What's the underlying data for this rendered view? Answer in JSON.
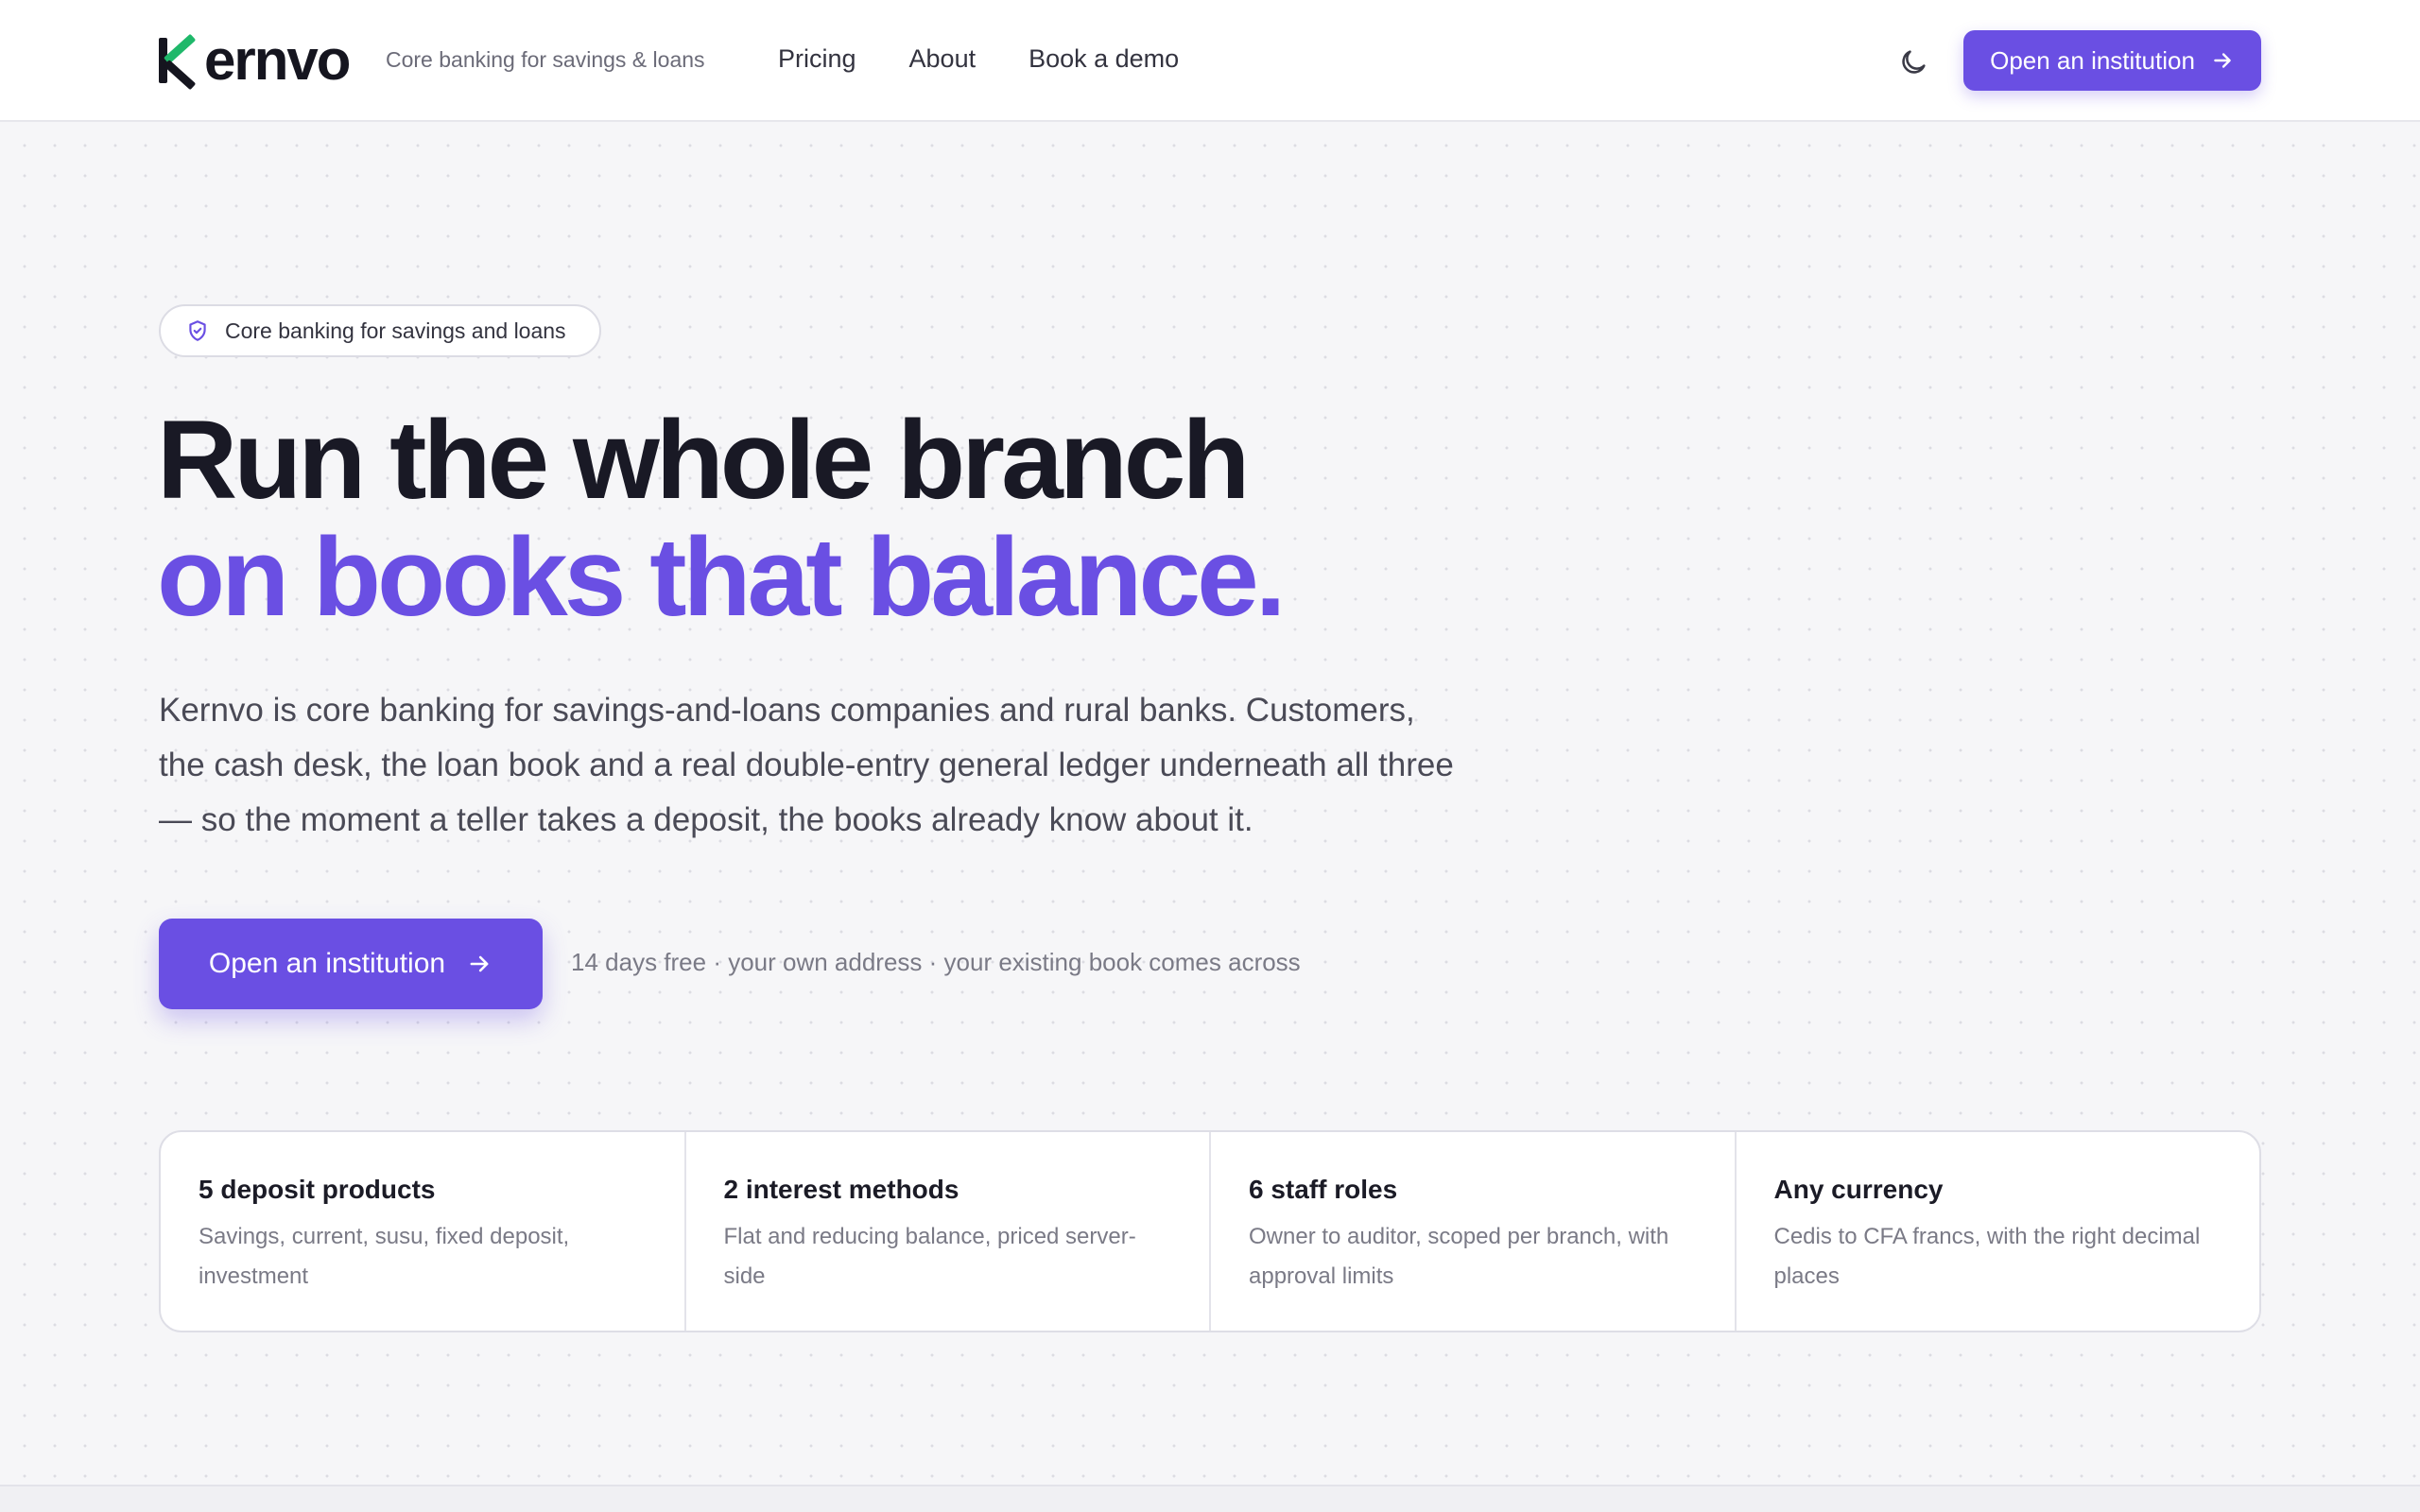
{
  "header": {
    "brand": "Kernvo",
    "brand_rest": "ernvo",
    "tagline": "Core banking for savings & loans",
    "nav": [
      "Pricing",
      "About",
      "Book a demo"
    ],
    "cta_label": "Open an institution",
    "theme_icon": "moon-icon"
  },
  "hero": {
    "badge_icon": "shield-check-icon",
    "badge_text": "Core banking for savings and loans",
    "title_line1": "Run the whole branch",
    "title_line2": "on books that balance.",
    "lead": "Kernvo is core banking for savings-and-loans companies and rural banks. Customers, the cash desk, the loan book and a real double-entry general ledger underneath all three — so the moment a teller takes a deposit, the books already know about it.",
    "cta_label": "Open an institution",
    "cta_note": "14 days free · your own address · your existing book comes across"
  },
  "stats": [
    {
      "title": "5 deposit products",
      "desc": "Savings, current, susu, fixed deposit, investment"
    },
    {
      "title": "2 interest methods",
      "desc": "Flat and reducing balance, priced server-side"
    },
    {
      "title": "6 staff roles",
      "desc": "Owner to auditor, scoped per branch, with approval limits"
    },
    {
      "title": "Any currency",
      "desc": "Cedis to CFA francs, with the right decimal places"
    }
  ],
  "colors": {
    "accent": "#6a4fe3",
    "logo_green": "#1fb86a",
    "text_dark": "#191925",
    "background": "#f6f6f8"
  }
}
